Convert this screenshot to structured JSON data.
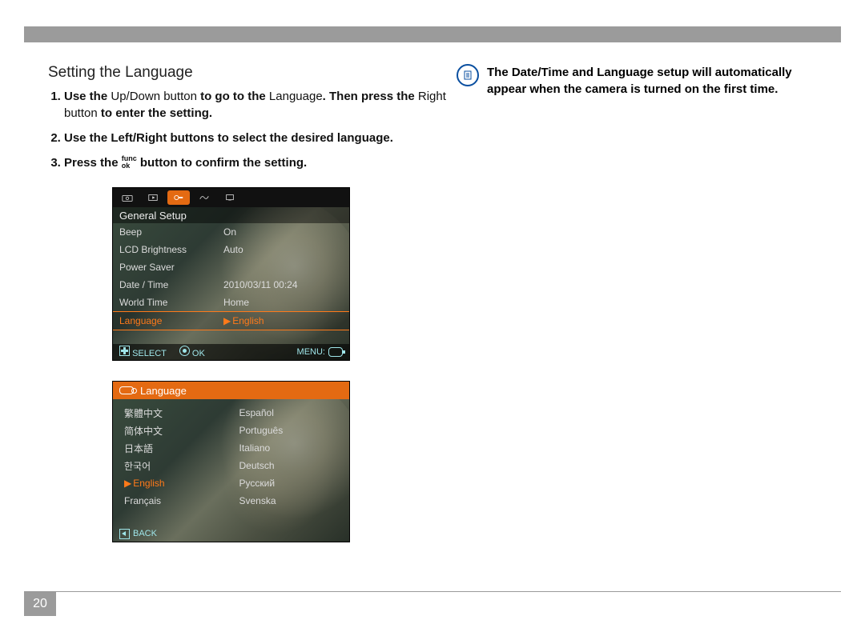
{
  "page_number": "20",
  "section_title": "Setting the Language",
  "steps": [
    {
      "pre": "Use the ",
      "mix1": "Up/Down button",
      "mid": " to go to the ",
      "mix2": "Language",
      "mid2": ". Then press the ",
      "mix3": "Right button",
      "post": " to enter the setting."
    },
    {
      "full": "Use the Left/Right buttons to select the desired language."
    },
    {
      "pre": "Press the ",
      "post": " button to confirm the setting."
    }
  ],
  "func_top": "func",
  "func_bot": "ok",
  "note_text": "The Date/Time and Language setup will automatically appear when the camera is turned on the first time.",
  "screen1": {
    "title": "General Setup",
    "rows": [
      {
        "label": "Beep",
        "value": "On"
      },
      {
        "label": "LCD Brightness",
        "value": "Auto"
      },
      {
        "label": "Power Saver",
        "value": ""
      },
      {
        "label": "Date / Time",
        "value": "2010/03/11 00:24"
      },
      {
        "label": "World Time",
        "value": "Home"
      },
      {
        "label": "Language",
        "value": "English",
        "selected": true
      }
    ],
    "footer": {
      "select": "SELECT",
      "ok": "OK",
      "menu": "MENU:"
    }
  },
  "screen2": {
    "title": "Language",
    "left_col": [
      "繁體中文",
      "简体中文",
      "日本語",
      "한국어",
      "English",
      "Français"
    ],
    "right_col": [
      "Español",
      "Português",
      "Italiano",
      "Deutsch",
      "Русский",
      "Svenska"
    ],
    "selected_index": 4,
    "back": "BACK"
  }
}
